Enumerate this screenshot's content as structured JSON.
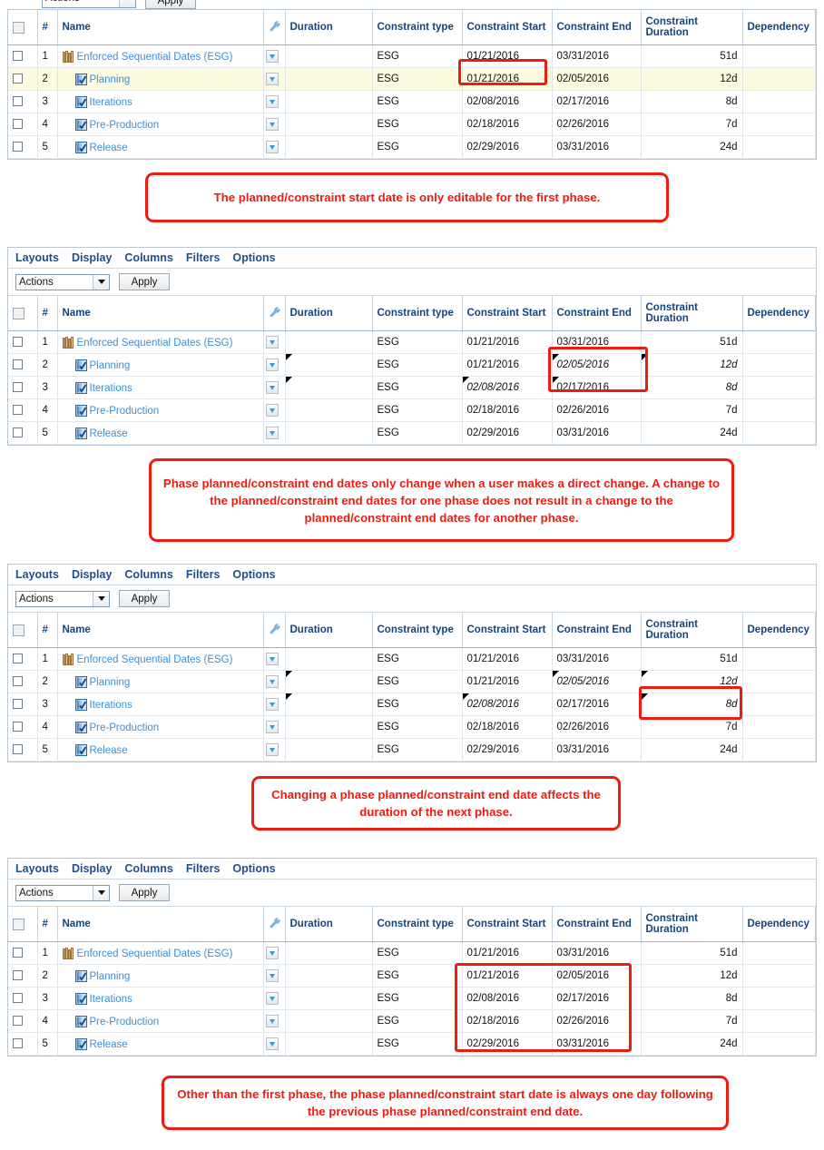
{
  "toolbar": {
    "menu_items": [
      "Layouts",
      "Display",
      "Columns",
      "Filters",
      "Options"
    ],
    "actions_select_value": "Actions",
    "apply_label": "Apply"
  },
  "columns": [
    {
      "key": "check",
      "label": ""
    },
    {
      "key": "num",
      "label": "#"
    },
    {
      "key": "name",
      "label": "Name"
    },
    {
      "key": "wrench",
      "label": ""
    },
    {
      "key": "duration",
      "label": "Duration"
    },
    {
      "key": "ctype",
      "label": "Constraint type"
    },
    {
      "key": "cstart",
      "label": "Constraint Start"
    },
    {
      "key": "cend",
      "label": "Constraint End"
    },
    {
      "key": "cdur",
      "label": "Constraint Duration"
    },
    {
      "key": "dep",
      "label": "Dependency"
    }
  ],
  "icons": {
    "wrench": "wrench-icon",
    "project": "project-books-icon",
    "phase": "phase-checked-icon",
    "row_menu": "chevron-down-icon"
  },
  "rows": [
    {
      "num": "1",
      "name": "Enforced Sequential Dates (ESG)",
      "icon": "project",
      "indent": 0,
      "duration": "",
      "ctype": "ESG",
      "cstart": "01/21/2016",
      "cend": "03/31/2016",
      "cdur": "51d",
      "dep": ""
    },
    {
      "num": "2",
      "name": "Planning",
      "icon": "phase",
      "indent": 1,
      "duration": "",
      "ctype": "ESG",
      "cstart": "01/21/2016",
      "cend": "02/05/2016",
      "cdur": "12d",
      "dep": ""
    },
    {
      "num": "3",
      "name": "Iterations",
      "icon": "phase",
      "indent": 1,
      "duration": "",
      "ctype": "ESG",
      "cstart": "02/08/2016",
      "cend": "02/17/2016",
      "cdur": "8d",
      "dep": ""
    },
    {
      "num": "4",
      "name": "Pre-Production",
      "icon": "phase",
      "indent": 1,
      "duration": "",
      "ctype": "ESG",
      "cstart": "02/18/2016",
      "cend": "02/26/2016",
      "cdur": "7d",
      "dep": ""
    },
    {
      "num": "5",
      "name": "Release",
      "icon": "phase",
      "indent": 1,
      "duration": "",
      "ctype": "ESG",
      "cstart": "02/29/2016",
      "cend": "03/31/2016",
      "cdur": "24d",
      "dep": ""
    }
  ],
  "panels": [
    {
      "id": "panel1",
      "has_menubar": false,
      "has_actionbar": false,
      "highlighted_row": 1,
      "dirty_cells": [],
      "italic_cells": []
    },
    {
      "id": "panel2",
      "has_menubar": true,
      "has_actionbar": true,
      "highlighted_row": -1,
      "dirty_cells": [
        [
          1,
          "duration"
        ],
        [
          1,
          "cend"
        ],
        [
          1,
          "cdur"
        ],
        [
          2,
          "duration"
        ],
        [
          2,
          "cstart"
        ],
        [
          2,
          "cend"
        ]
      ],
      "italic_cells": [
        [
          1,
          "cend"
        ],
        [
          1,
          "cdur"
        ],
        [
          2,
          "cstart"
        ],
        [
          2,
          "cdur"
        ]
      ]
    },
    {
      "id": "panel3",
      "has_menubar": true,
      "has_actionbar": true,
      "highlighted_row": -1,
      "dirty_cells": [
        [
          1,
          "duration"
        ],
        [
          1,
          "cend"
        ],
        [
          1,
          "cdur"
        ],
        [
          2,
          "duration"
        ],
        [
          2,
          "cstart"
        ],
        [
          2,
          "cdur"
        ]
      ],
      "italic_cells": [
        [
          1,
          "cend"
        ],
        [
          1,
          "cdur"
        ],
        [
          2,
          "cstart"
        ],
        [
          2,
          "cdur"
        ]
      ]
    },
    {
      "id": "panel4",
      "has_menubar": true,
      "has_actionbar": true,
      "highlighted_row": -1,
      "dirty_cells": [],
      "italic_cells": []
    }
  ],
  "callouts": [
    {
      "id": "callout1",
      "text": "The planned/constraint start date is only editable for the first phase."
    },
    {
      "id": "callout2",
      "text": "Phase planned/constraint end dates only change when a user makes a direct change. A change to the planned/constraint end dates for one phase does not result in a change to the planned/constraint end dates for another phase."
    },
    {
      "id": "callout3",
      "text": "Changing a phase planned/constraint end date affects the duration of the next phase."
    },
    {
      "id": "callout4",
      "text": "Other than the first phase, the phase planned/constraint start date is always one day following the previous phase planned/constraint end date."
    }
  ],
  "colors": {
    "annotation_red": "#ee1b11",
    "link_blue": "#3b8fd4",
    "header_blue": "#14447e",
    "row_highlight_yellow": "#fcfbdf",
    "cell_underline_green": "#5fc35f"
  }
}
